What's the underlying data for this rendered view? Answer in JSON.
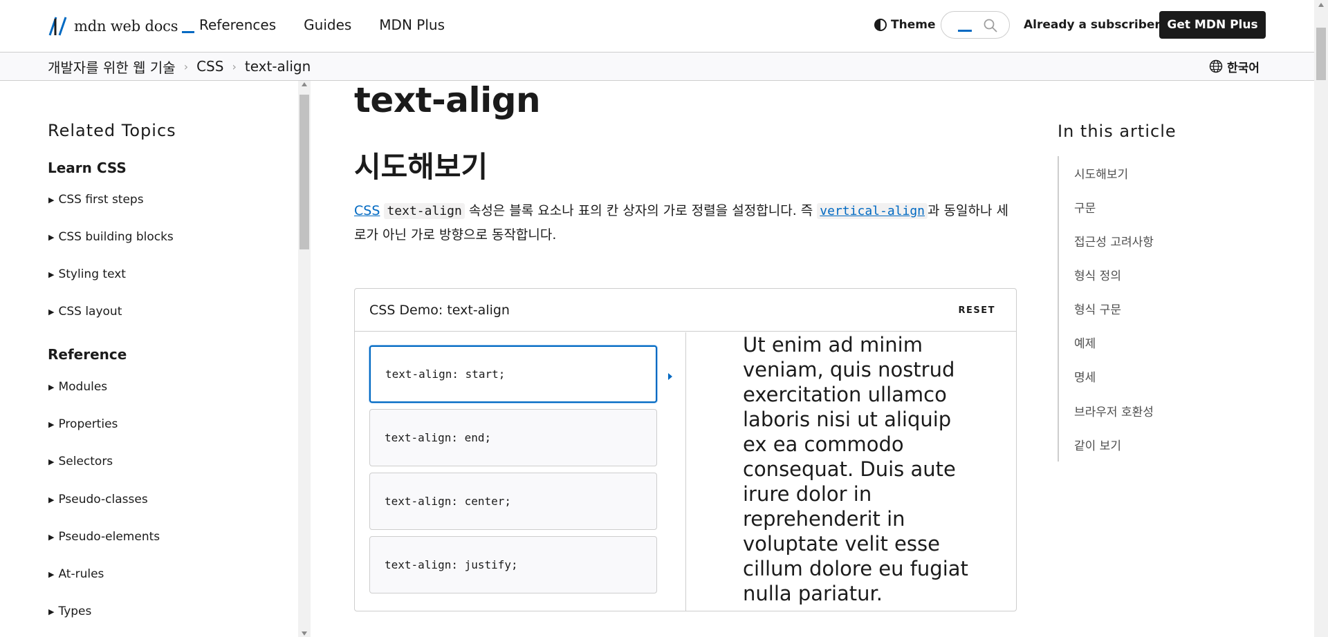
{
  "header": {
    "logo_text": "mdn web docs",
    "nav": [
      "References",
      "Guides",
      "MDN Plus"
    ],
    "theme_label": "Theme",
    "subscriber_label": "Already a subscriber?",
    "get_plus_label": "Get MDN Plus"
  },
  "breadcrumb": {
    "items": [
      "개발자를 위한 웹 기술",
      "CSS",
      "text-align"
    ],
    "separator": "›",
    "language": "한국어"
  },
  "sidebar": {
    "heading": "Related Topics",
    "learn_title": "Learn CSS",
    "learn_items": [
      "CSS first steps",
      "CSS building blocks",
      "Styling text",
      "CSS layout"
    ],
    "reference_title": "Reference",
    "reference_items": [
      "Modules",
      "Properties",
      "Selectors",
      "Pseudo-classes",
      "Pseudo-elements",
      "At-rules",
      "Types"
    ]
  },
  "main": {
    "title": "text-align",
    "section_title": "시도해보기",
    "intro": {
      "link_css": "CSS",
      "code_prop": "text-align",
      "text_1": " 속성은 블록 요소나 표의 칸 상자의 가로 정렬을 설정합니다. 즉 ",
      "link_code": "vertical-align",
      "text_2": "과 동일하나 세로가 아닌 가로 방향으로 동작합니다."
    }
  },
  "demo": {
    "title": "CSS Demo: text-align",
    "reset_label": "RESET",
    "choices": [
      "text-align: start;",
      "text-align: end;",
      "text-align: center;",
      "text-align: justify;"
    ],
    "selected_index": 0,
    "output_text": "Ut enim ad minim veniam, quis nostrud exercitation ullamco laboris nisi ut aliquip ex ea commodo consequat. Duis aute irure dolor in reprehenderit in voluptate velit esse cillum dolore eu fugiat nulla pariatur."
  },
  "toc": {
    "title": "In this article",
    "items": [
      "시도해보기",
      "구문",
      "접근성 고려사항",
      "형식 정의",
      "형식 구문",
      "예제",
      "명세",
      "브라우저 호환성",
      "같이 보기"
    ]
  },
  "colors": {
    "accent": "#0069c2",
    "text": "#1b1b1b",
    "border": "#cdcdcd"
  }
}
